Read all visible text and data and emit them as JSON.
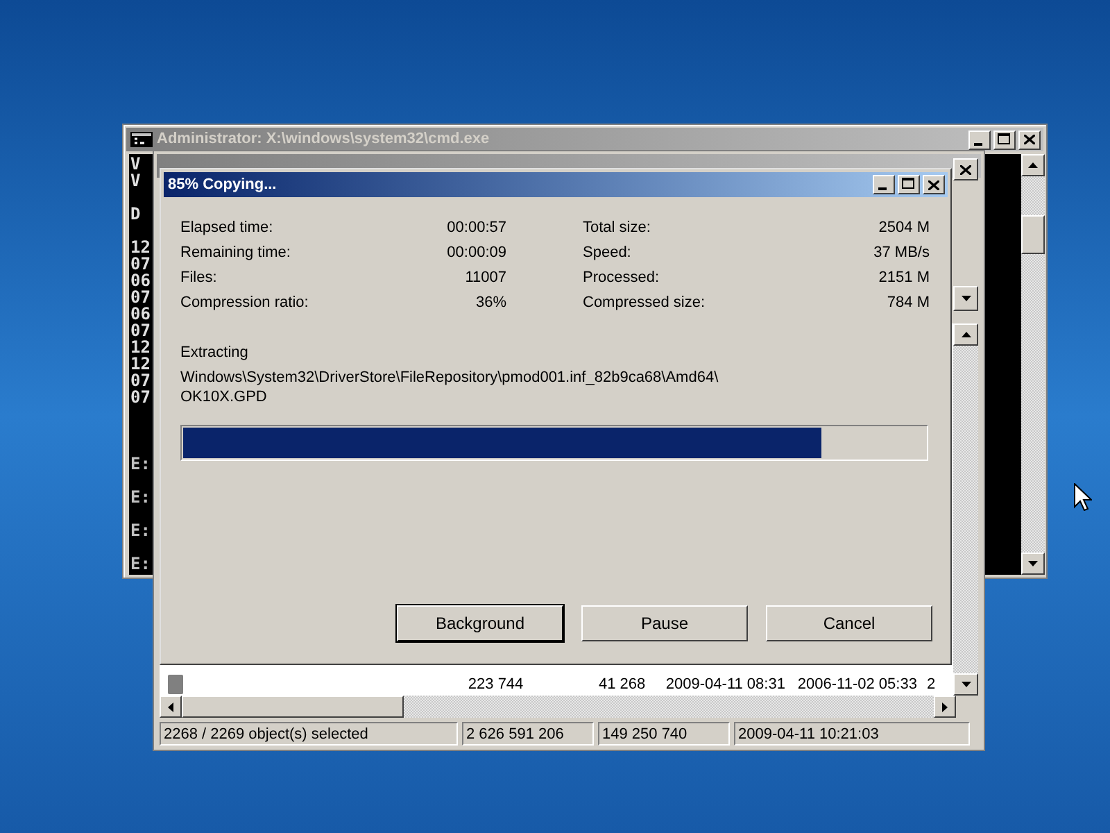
{
  "console_window": {
    "title": "Administrator: X:\\windows\\system32\\cmd.exe",
    "console_groups": [
      {
        "kind": "output",
        "lines": [
          "V",
          "V"
        ]
      },
      {
        "kind": "output",
        "lines": [
          "D"
        ]
      },
      {
        "kind": "output",
        "lines": [
          "12",
          "07",
          "06",
          "07",
          "06",
          "07",
          "12",
          "12",
          "07",
          "07"
        ]
      },
      {
        "kind": "prompt",
        "lines": [
          "E:"
        ]
      },
      {
        "kind": "prompt",
        "lines": [
          "E:"
        ]
      },
      {
        "kind": "prompt",
        "lines": [
          "E:"
        ]
      },
      {
        "kind": "prompt",
        "lines": [
          "E:"
        ]
      }
    ]
  },
  "file_manager": {
    "rows": [
      {
        "cells": [
          "223 744",
          "41 268",
          "2009-04-11 08:31",
          "2006-11-02 05:33",
          "2"
        ]
      }
    ],
    "status_bar": [
      "2268 / 2269 object(s) selected",
      "2 626 591 206",
      "149 250 740",
      "2009-04-11 10:21:03"
    ]
  },
  "copy_dialog": {
    "title": "85% Copying...",
    "stats_left": [
      {
        "label": "Elapsed time:",
        "value": "00:00:57"
      },
      {
        "label": "Remaining time:",
        "value": "00:00:09"
      },
      {
        "label": "Files:",
        "value": "11007"
      },
      {
        "label": "Compression ratio:",
        "value": "36%"
      }
    ],
    "stats_right": [
      {
        "label": "Total size:",
        "value": "2504 M"
      },
      {
        "label": "Speed:",
        "value": "37 MB/s"
      },
      {
        "label": "Processed:",
        "value": "2151 M"
      },
      {
        "label": "Compressed size:",
        "value": "784 M"
      }
    ],
    "action": "Extracting",
    "path": [
      "Windows\\System32\\DriverStore\\FileRepository\\pmod001.inf_82b9ca68\\Amd64\\",
      "OK10X.GPD"
    ],
    "progress": {
      "level": 0.86
    },
    "buttons": [
      {
        "label": "Background",
        "default": true
      },
      {
        "label": "Pause",
        "default": false
      },
      {
        "label": "Cancel",
        "default": false
      }
    ]
  }
}
